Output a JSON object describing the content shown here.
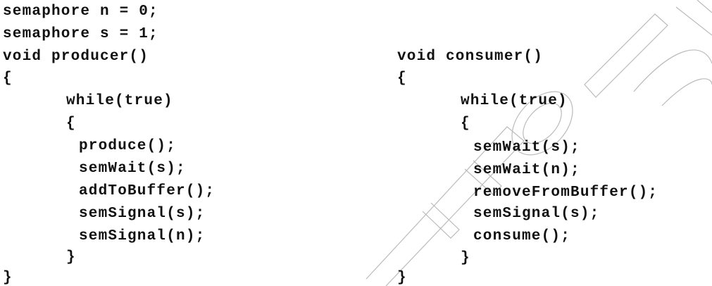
{
  "watermark": {
    "text": "TE2012",
    "stroke_color": "#bbbbbb"
  },
  "code": {
    "declarations": [
      "semaphore n = 0;",
      "semaphore s = 1;"
    ],
    "producer": {
      "signature": "void producer()",
      "open_brace": "{",
      "loop": "while(true)",
      "loop_open": "{",
      "body": [
        "produce();",
        "semWait(s);",
        "addToBuffer();",
        "semSignal(s);",
        "semSignal(n);"
      ],
      "loop_close": "}",
      "close_brace": "}"
    },
    "consumer": {
      "signature": "void consumer()",
      "open_brace": "{",
      "loop": "while(true)",
      "loop_open": "{",
      "body": [
        "semWait(s);",
        "semWait(n);",
        "removeFromBuffer();",
        "semSignal(s);",
        "consume();"
      ],
      "loop_close": "}",
      "close_brace": "}"
    }
  }
}
